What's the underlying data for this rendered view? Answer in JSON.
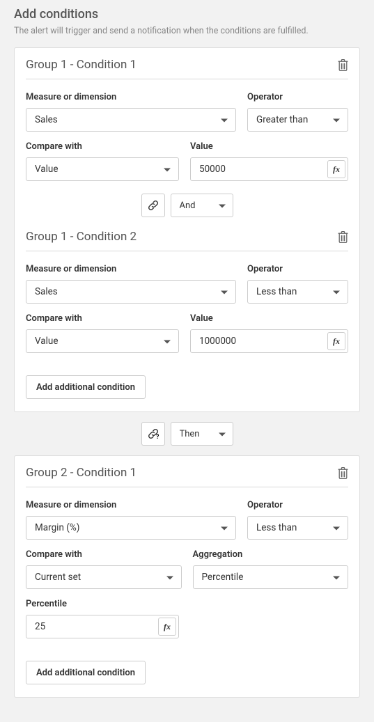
{
  "header": {
    "title": "Add conditions",
    "subtitle": "The alert will trigger and send a notification when the conditions are fulfilled."
  },
  "groups": [
    {
      "conditions": [
        {
          "title": "Group 1 - Condition 1",
          "fields": {
            "measure_label": "Measure or dimension",
            "measure_value": "Sales",
            "operator_label": "Operator",
            "operator_value": "Greater than",
            "compare_label": "Compare with",
            "compare_value": "Value",
            "value_label": "Value",
            "value_value": "50000"
          }
        },
        {
          "title": "Group 1 - Condition 2",
          "fields": {
            "measure_label": "Measure or dimension",
            "measure_value": "Sales",
            "operator_label": "Operator",
            "operator_value": "Less than",
            "compare_label": "Compare with",
            "compare_value": "Value",
            "value_label": "Value",
            "value_value": "1000000"
          }
        }
      ],
      "inner_connector": "And",
      "add_label": "Add additional condition"
    },
    {
      "conditions": [
        {
          "title": "Group 2 - Condition 1",
          "fields": {
            "measure_label": "Measure or dimension",
            "measure_value": "Margin (%)",
            "operator_label": "Operator",
            "operator_value": "Less than",
            "compare_label": "Compare with",
            "compare_value": "Current set",
            "aggregation_label": "Aggregation",
            "aggregation_value": "Percentile",
            "percentile_label": "Percentile",
            "percentile_value": "25"
          }
        }
      ],
      "add_label": "Add additional condition"
    }
  ],
  "outer_connector": "Then"
}
